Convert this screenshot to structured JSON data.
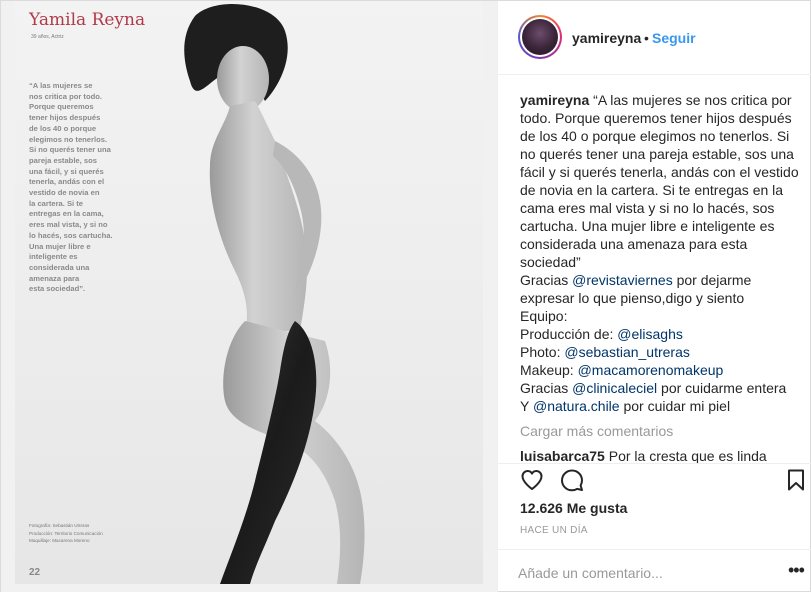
{
  "magazine": {
    "title": "Yamila Reyna",
    "subtitle": "39 años, Actriz",
    "quote": "“A las mujeres se\nnos critica por todo.\nPorque queremos\ntener hijos después\nde los 40 o porque\nelegimos no tenerlos.\nSi no querés tener una\npareja estable, sos\nuna fácil, y si querés\ntenerla, andás con el\nvestido de novia en\nla cartera. Si te\nentregas en la cama,\neres mal vista, y si no\nlo hacés, sos cartucha.\nUna mujer libre e\ninteligente es\nconsiderada una\namenaza para\nesta sociedad”.",
    "credits": "Fotografía: Sebastián Utreras\nProducción: Territorio Comunicación\nMaquillaje: Macarena Moreno",
    "page_number": "22"
  },
  "header": {
    "username": "yamireyna",
    "separator": "•",
    "follow_label": "Seguir"
  },
  "caption": {
    "username": "yamireyna",
    "lines": {
      "l1": "“A las mujeres se nos critica por todo. Porque queremos tener hijos después de los 40 o porque elegimos no tenerlos. Si no querés tener una pareja estable, sos una fácil y si querés tenerla, andás con el vestido de novia en la cartera. Si te entregas en la cama eres mal vista y si no lo hacés, sos cartucha. Una mujer libre e inteligente es considerada una amenaza para esta sociedad”",
      "thanks_pre": "Gracias ",
      "thanks_mention": "@revistaviernes",
      "thanks_post": " por dejarme expresar lo que pienso,digo y siento",
      "equipo": "Equipo:",
      "prod_pre": "Producción de: ",
      "prod_mention": "@elisaghs",
      "photo_pre": "Photo: ",
      "photo_mention": "@sebastian_utreras",
      "makeup_pre": "Makeup: ",
      "makeup_mention": "@macamorenomakeup",
      "clinic_pre": "Gracias ",
      "clinic_mention": "@clinicaleciel",
      "clinic_post": " por cuidarme entera",
      "natura_pre": "Y ",
      "natura_mention": "@natura.chile",
      "natura_post": " por cuidar mi piel"
    }
  },
  "load_more_label": "Cargar más comentarios",
  "partial_comment": {
    "username": "luisabarca75",
    "text": "Por la cresta que es linda"
  },
  "likes": "12.626 Me gusta",
  "timestamp": "HACE UN DÍA",
  "comment_input": {
    "placeholder": "Añade un comentario..."
  },
  "more_options": "•••",
  "icons": [
    "heart-icon",
    "comment-icon",
    "bookmark-icon",
    "more-options-icon"
  ]
}
